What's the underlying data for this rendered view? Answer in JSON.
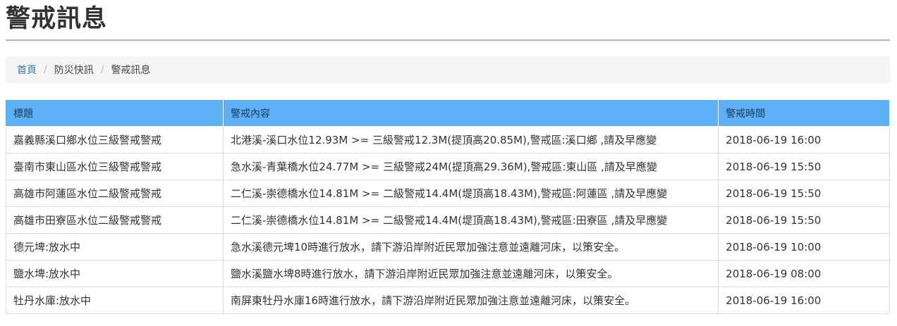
{
  "page": {
    "title": "警戒訊息"
  },
  "breadcrumb": {
    "home": "首頁",
    "separator": "/",
    "section": "防災快訊",
    "current": "警戒訊息"
  },
  "table": {
    "headers": [
      "標題",
      "警戒內容",
      "警戒時間"
    ],
    "rows": [
      [
        "嘉義縣溪口鄉水位三級警戒警戒",
        "北港溪-溪口水位12.93M >= 三級警戒12.3M(提頂高20.85M),警戒區:溪口鄉 ,請及早應變",
        "2018-06-19 16:00"
      ],
      [
        "臺南市東山區水位三級警戒警戒",
        "急水溪-青葉橋水位24.77M >= 三級警戒24M(提頂高29.36M),警戒區:東山區 ,請及早應變",
        "2018-06-19 15:50"
      ],
      [
        "高雄市阿蓮區水位二級警戒警戒",
        "二仁溪-崇德橋水位14.81M >= 二級警戒14.4M(堤頂高18.43M),警戒區:阿蓮區 ,請及早應變",
        "2018-06-19 15:50"
      ],
      [
        "高雄市田寮區水位二級警戒警戒",
        "二仁溪-崇德橋水位14.81M >= 二級警戒14.4M(堤頂高18.43M),警戒區:田寮區 ,請及早應變",
        "2018-06-19 15:50"
      ],
      [
        "德元埤:放水中",
        "急水溪德元埤10時進行放水，請下游沿岸附近民眾加強注意並遠離河床，以策安全。",
        "2018-06-19 10:00"
      ],
      [
        "鹽水埤:放水中",
        "鹽水溪鹽水埤8時進行放水，請下游沿岸附近民眾加強注意並遠離河床，以策安全。",
        "2018-06-19 08:00"
      ],
      [
        "牡丹水庫:放水中",
        "南屏東牡丹水庫16時進行放水，請下游沿岸附近民眾加強注意並遠離河床，以策安全。",
        "2018-06-19 16:00"
      ]
    ]
  }
}
